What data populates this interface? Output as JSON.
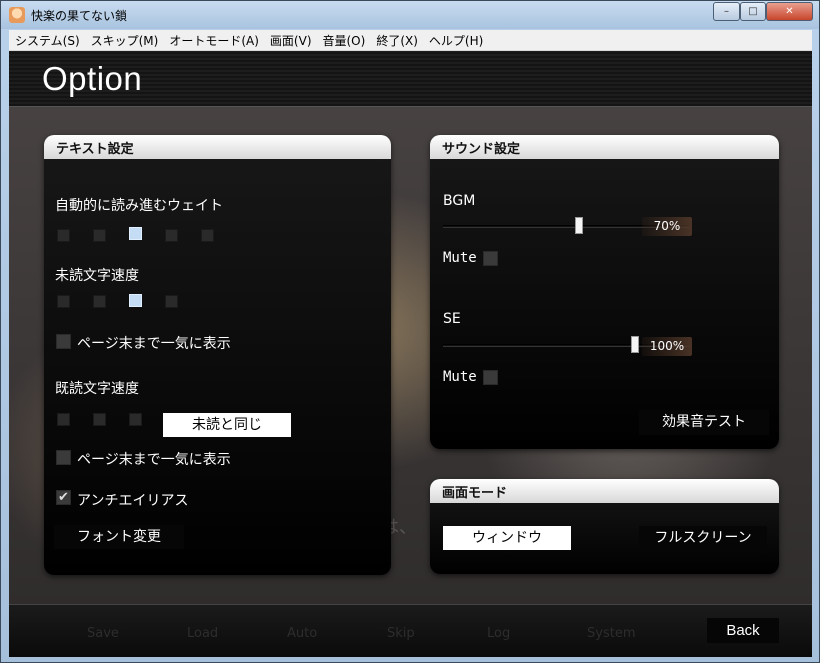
{
  "window": {
    "title": "快楽の果てない鎖",
    "controls": {
      "minimize": "–",
      "maximize": "□",
      "close": "✕"
    }
  },
  "menubar": {
    "items": [
      "システム(S)",
      "スキップ(M)",
      "オートモード(A)",
      "画面(V)",
      "音量(O)",
      "終了(X)",
      "ヘルプ(H)"
    ]
  },
  "header": {
    "title": "Option"
  },
  "text_panel": {
    "title": "テキスト設定",
    "auto_wait": {
      "label": "自動的に読み進むウェイト",
      "levels": 5,
      "selected": 3
    },
    "unread_speed": {
      "label": "未読文字速度",
      "levels": 4,
      "selected": 3
    },
    "unread_page_end": {
      "label": "ページ末まで一気に表示",
      "checked": false
    },
    "read_speed": {
      "label": "既読文字速度",
      "levels": 3,
      "same_as_unread_label": "未読と同じ"
    },
    "read_page_end": {
      "label": "ページ末まで一気に表示",
      "checked": false
    },
    "antialias": {
      "label": "アンチエイリアス",
      "checked": true
    },
    "font_button": "フォント変更"
  },
  "sound_panel": {
    "title": "サウンド設定",
    "bgm": {
      "label": "BGM",
      "value": 70,
      "value_text": "70%",
      "mute_label": "Mute",
      "muted": false
    },
    "se": {
      "label": "SE",
      "value": 100,
      "value_text": "100%",
      "mute_label": "Mute",
      "muted": false
    },
    "test_button": "効果音テスト"
  },
  "screen_panel": {
    "title": "画面モード",
    "window_label": "ウィンドウ",
    "fullscreen_label": "フルスクリーン",
    "selected": "window"
  },
  "background_text": "は、",
  "bottom_bar": {
    "ghost_items": [
      "Save",
      "Load",
      "Auto",
      "Skip",
      "Log",
      "System"
    ],
    "back_label": "Back"
  },
  "colors": {
    "accent_selected": "#c5dcf5",
    "panel_bg": "#000000",
    "panel_header": "#ffffff"
  }
}
